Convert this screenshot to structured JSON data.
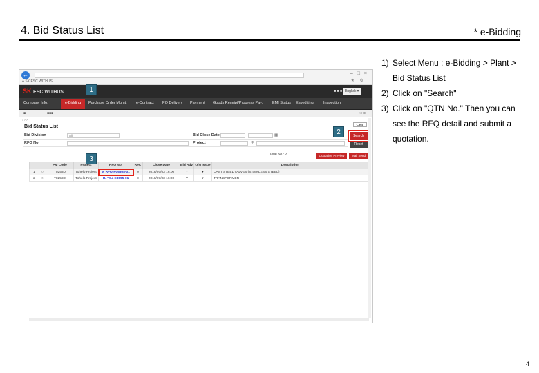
{
  "slide": {
    "title": "4. Bid Status List",
    "tag": "* e-Bidding",
    "page_number": "4"
  },
  "instructions": [
    {
      "num": "1)",
      "text": "Select Menu : e-Bidding > Plant > Bid Status List"
    },
    {
      "num": "2)",
      "text": "Click on \"Search\""
    },
    {
      "num": "3)",
      "text": "Click on \"QTN No.\" Then you can see the RFQ detail and submit a quotation."
    }
  ],
  "screenshot": {
    "brand": "SK",
    "brand_suffix": "ESC WITHUS",
    "menu": [
      "Company Info.",
      "e-Bidding",
      "Purchase Order Mgmt.",
      "e-Contract",
      "PO Delivery",
      "Payment",
      "Goods Receipt/Progress Pay.",
      "EMI Status",
      "Expediting",
      "Inspection"
    ],
    "active_menu_index": 1,
    "page_title": "Bid Status List",
    "buttons": {
      "search": "Search",
      "reset": "Reset",
      "clear": "Clear",
      "quotation_preview": "Quotation Preview",
      "mail_send": "Mail Send"
    },
    "filters": {
      "bid_division_label": "Bid Division",
      "bid_division_value": "All",
      "bid_close_date_label": "Bid Close Date",
      "rfq_no_label": "RFQ No",
      "project_label": "Project"
    },
    "total": "Total No : 2",
    "table": {
      "headers": [
        "",
        "",
        "PM Code",
        "Project",
        "RFQ No.",
        "Rev.",
        "Close Date",
        "Bid Adv.",
        "Q/N Issue",
        "Description"
      ],
      "rows": [
        [
          "1",
          "",
          "T0258D",
          "Tohelo Project",
          "V. RFQ-P06308-01",
          "0",
          "2018/07/03 16:00",
          "Y",
          "",
          "CAST STEEL VALVES (STAINLESS STEEL)"
        ],
        [
          "2",
          "",
          "T0258D",
          "Tohelo Project",
          "U.-TSJ-E8095-01",
          "0",
          "2018/07/03 16:00",
          "Y",
          "",
          "TRANSFORMER"
        ]
      ]
    },
    "markers": [
      "1",
      "2",
      "3"
    ]
  }
}
